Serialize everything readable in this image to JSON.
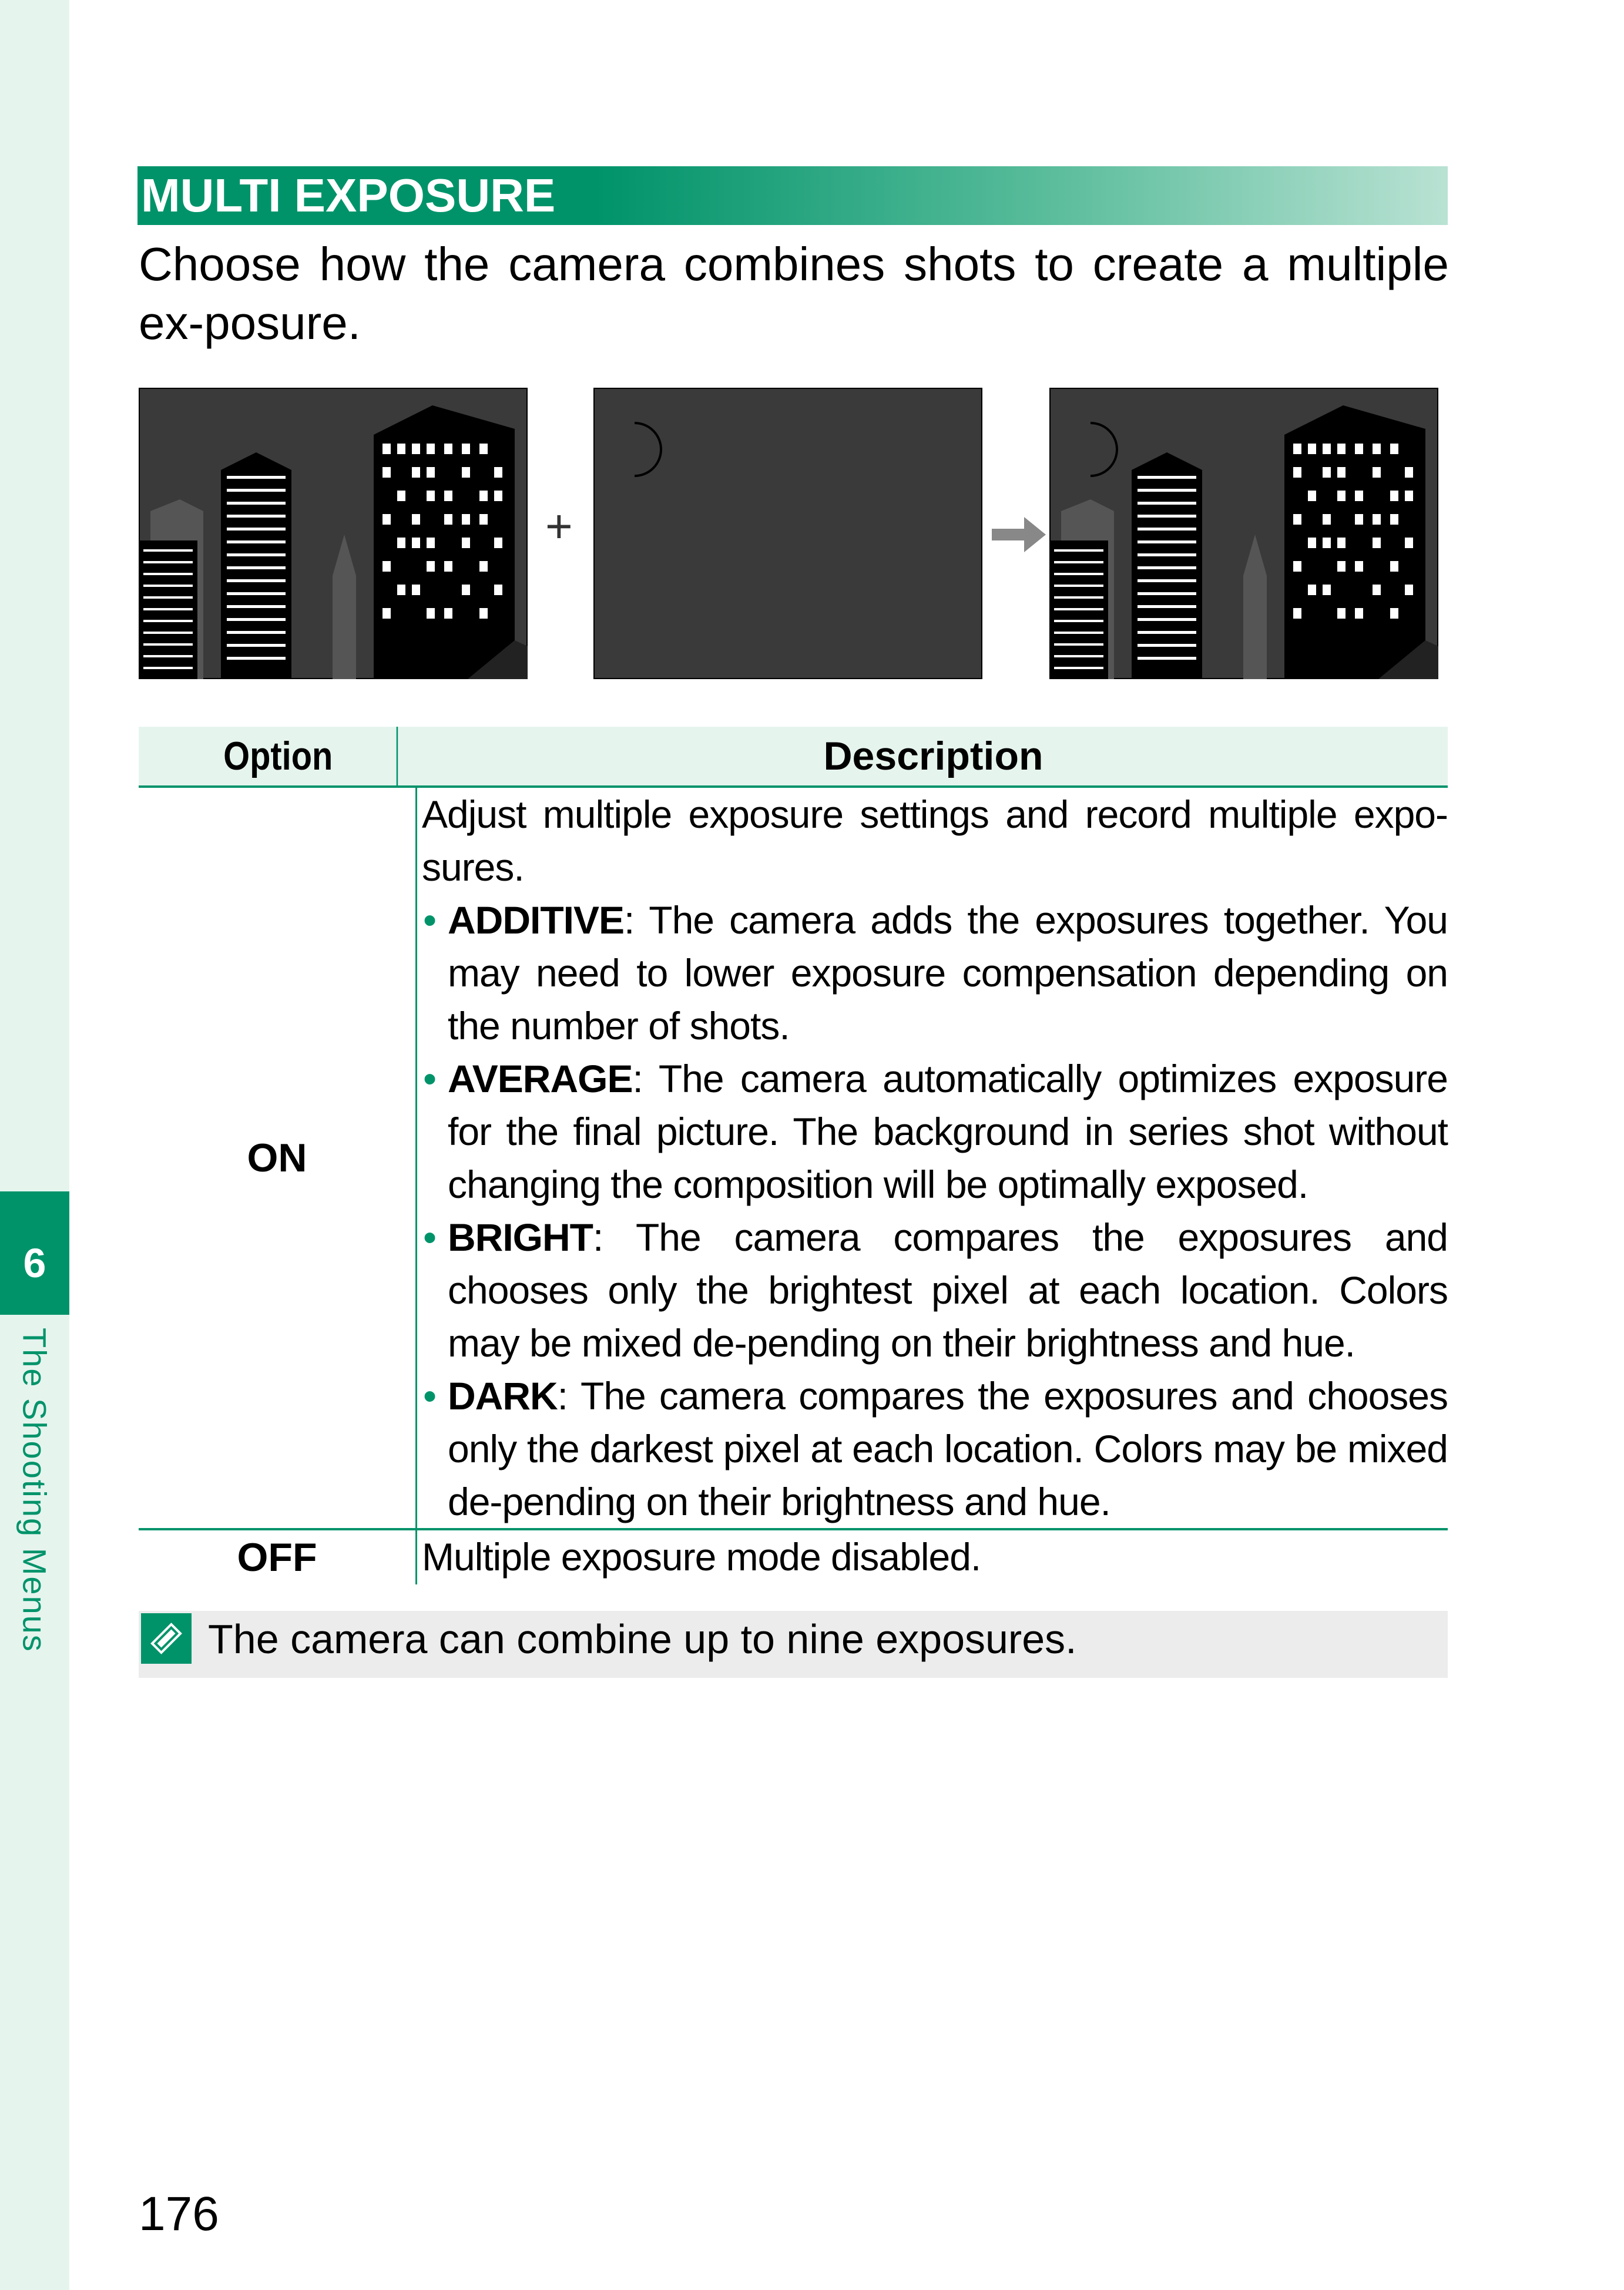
{
  "sidebar": {
    "chapter_number": "6",
    "chapter_label": "The Shooting Menus"
  },
  "section": {
    "title": "MULTI EXPOSURE",
    "intro": "Choose how the camera combines shots to create a multiple ex-posure."
  },
  "illustration": {
    "operator_plus": "+",
    "icons": [
      "city-night-icon",
      "moon-icon",
      "arrow-right-icon",
      "combined-icon"
    ]
  },
  "table": {
    "header_option": "Option",
    "header_description": "Description",
    "rows": [
      {
        "option": "ON",
        "description": "Adjust multiple exposure settings and record multiple expo-sures.",
        "bullets": [
          {
            "term": "ADDITIVE",
            "text": ": The camera adds the exposures together. You may need to lower exposure compensation depending on the number of shots."
          },
          {
            "term": "AVERAGE",
            "text": ": The camera automatically optimizes exposure for the final picture. The background in series shot without changing the composition will be optimally exposed."
          },
          {
            "term": "BRIGHT",
            "text": ": The camera compares the exposures and chooses only the brightest pixel at each location. Colors may be mixed de-pending on their brightness and hue."
          },
          {
            "term": "DARK",
            "text": ": The camera compares the exposures and chooses only the darkest pixel at each location. Colors may be mixed de-pending on their brightness and hue."
          }
        ]
      },
      {
        "option": "OFF",
        "description": "Multiple exposure mode disabled."
      }
    ]
  },
  "note": {
    "text": "The camera can combine up to nine exposures."
  },
  "page_number": "176",
  "colors": {
    "accent": "#00936a",
    "light_accent": "#e6f4ee",
    "note_bg": "#ececec"
  }
}
